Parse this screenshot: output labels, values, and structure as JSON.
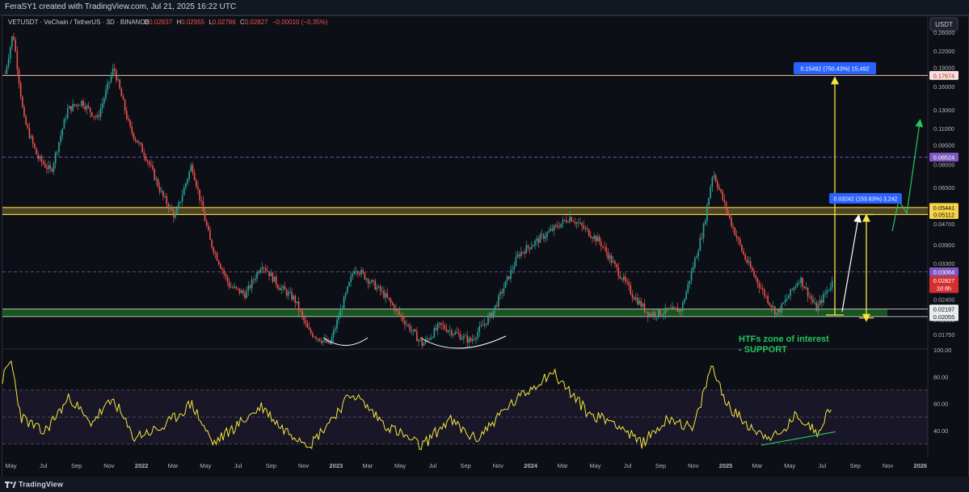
{
  "header": {
    "attribution": "FeraSY1 created with TradingView.com, Jul 21, 2025 16:22 UTC",
    "brand": "TradingView"
  },
  "legend": {
    "symbol": "VETUSDT · VeChain / TetherUS · 3D · BINANCE",
    "o_label": "O",
    "o_value": "0.02837",
    "h_label": "H",
    "h_value": "0.02955",
    "l_label": "L",
    "l_value": "0.02786",
    "c_label": "C",
    "c_value": "0.02827",
    "change": "−0.00010 (−0.35%)"
  },
  "price_axis": {
    "currency": "USDT",
    "scale": "log",
    "ticks": [
      "0.26000",
      "0.22000",
      "0.19000",
      "0.16000",
      "0.13000",
      "0.11000",
      "0.09500",
      "0.08000",
      "0.06500",
      "0.04700",
      "0.03900",
      "0.03300",
      "0.02400",
      "0.02000",
      "0.01750"
    ],
    "badges": [
      {
        "text": "0.17674",
        "value": 0.17674,
        "bg": "#f8e0dc",
        "fg": "#b03028"
      },
      {
        "text": "0.08524",
        "value": 0.08524,
        "bg": "#7e57c2",
        "fg": "#ffffff"
      },
      {
        "text": "0.05441",
        "value": 0.05441,
        "bg": "#f5d34a",
        "fg": "#111111"
      },
      {
        "text": "0.05112",
        "value": 0.05112,
        "bg": "#f5d34a",
        "fg": "#111111"
      },
      {
        "text": "0.03064",
        "value": 0.03064,
        "bg": "#7e57c2",
        "fg": "#ffffff"
      },
      {
        "text": "0.02197",
        "value": 0.02197,
        "bg": "#e8eaed",
        "fg": "#111111"
      },
      {
        "text": "0.02055",
        "value": 0.02055,
        "bg": "#e8eaed",
        "fg": "#111111"
      }
    ],
    "last_price": {
      "price": "0.02827",
      "countdown": "2d 8h",
      "value": 0.02827,
      "bg": "#d32f2f",
      "fg": "#ffffff"
    }
  },
  "time_axis": {
    "labels": [
      "May",
      "Jul",
      "Sep",
      "Nov",
      "2022",
      "Mar",
      "May",
      "Jul",
      "Sep",
      "Nov",
      "2023",
      "Mar",
      "May",
      "Jul",
      "Sep",
      "Nov",
      "2024",
      "Mar",
      "May",
      "Jul",
      "Sep",
      "Nov",
      "2025",
      "Mar",
      "May",
      "Jul",
      "Sep",
      "Nov",
      "2026"
    ],
    "bold_labels": [
      "2022",
      "2023",
      "2024",
      "2025",
      "2026"
    ]
  },
  "annotations": {
    "target_high": "0.15492 (750.43%) 15,492",
    "target_mid": "0.03242 (153.83%) 3,242",
    "zone_line1": "HTFs zone of interest",
    "zone_line2": "- SUPPORT"
  },
  "rsi_axis": {
    "ticks": [
      "100.00",
      "80.00",
      "60.00",
      "40.00"
    ]
  },
  "colors": {
    "up": "#26a69a",
    "down": "#ef5350",
    "rsi": "#f5e642",
    "support_zone": "#1b5e20",
    "resistance_zone": "#f5d34a",
    "dashed_level": "#7e57c2",
    "projection_yellow": "#f5e642",
    "projection_green": "#22c55e",
    "projection_white": "#ffffff",
    "label_blue": "#2962ff"
  },
  "chart_data": [
    {
      "type": "candlestick",
      "title": "VETUSDT · VeChain / TetherUS · 3D · BINANCE",
      "yscale": "log",
      "ylim": [
        0.0155,
        0.3
      ],
      "x_range": [
        "2021-04-15",
        "2026-01-15"
      ],
      "levels": {
        "resistance_zone": [
          0.05112,
          0.05441
        ],
        "support_zone": [
          0.02055,
          0.02197
        ],
        "dashed": [
          0.08524,
          0.03064
        ],
        "horizontal": [
          0.17674
        ]
      },
      "price_path": [
        {
          "t": "2021-04-20",
          "p": 0.18
        },
        {
          "t": "2021-05-05",
          "p": 0.26
        },
        {
          "t": "2021-05-25",
          "p": 0.12
        },
        {
          "t": "2021-06-20",
          "p": 0.085
        },
        {
          "t": "2021-07-15",
          "p": 0.075
        },
        {
          "t": "2021-08-15",
          "p": 0.13
        },
        {
          "t": "2021-09-10",
          "p": 0.14
        },
        {
          "t": "2021-10-10",
          "p": 0.12
        },
        {
          "t": "2021-11-10",
          "p": 0.19
        },
        {
          "t": "2021-12-10",
          "p": 0.11
        },
        {
          "t": "2022-01-10",
          "p": 0.085
        },
        {
          "t": "2022-02-10",
          "p": 0.06
        },
        {
          "t": "2022-03-05",
          "p": 0.05
        },
        {
          "t": "2022-04-05",
          "p": 0.08
        },
        {
          "t": "2022-05-10",
          "p": 0.04
        },
        {
          "t": "2022-06-15",
          "p": 0.027
        },
        {
          "t": "2022-07-15",
          "p": 0.025
        },
        {
          "t": "2022-08-15",
          "p": 0.033
        },
        {
          "t": "2022-09-15",
          "p": 0.027
        },
        {
          "t": "2022-10-15",
          "p": 0.024
        },
        {
          "t": "2022-11-10",
          "p": 0.018
        },
        {
          "t": "2022-12-20",
          "p": 0.016
        },
        {
          "t": "2023-02-05",
          "p": 0.032
        },
        {
          "t": "2023-04-01",
          "p": 0.025
        },
        {
          "t": "2023-06-12",
          "p": 0.016
        },
        {
          "t": "2023-07-15",
          "p": 0.019
        },
        {
          "t": "2023-09-10",
          "p": 0.0165
        },
        {
          "t": "2023-10-20",
          "p": 0.021
        },
        {
          "t": "2023-12-10",
          "p": 0.036
        },
        {
          "t": "2024-03-15",
          "p": 0.05
        },
        {
          "t": "2024-05-10",
          "p": 0.04
        },
        {
          "t": "2024-07-10",
          "p": 0.025
        },
        {
          "t": "2024-08-10",
          "p": 0.021
        },
        {
          "t": "2024-10-10",
          "p": 0.022
        },
        {
          "t": "2024-11-20",
          "p": 0.045
        },
        {
          "t": "2024-12-08",
          "p": 0.075
        },
        {
          "t": "2025-01-10",
          "p": 0.048
        },
        {
          "t": "2025-02-05",
          "p": 0.035
        },
        {
          "t": "2025-03-10",
          "p": 0.026
        },
        {
          "t": "2025-04-07",
          "p": 0.021
        },
        {
          "t": "2025-05-20",
          "p": 0.029
        },
        {
          "t": "2025-06-20",
          "p": 0.022
        },
        {
          "t": "2025-07-21",
          "p": 0.02827
        }
      ],
      "ohlc_last": {
        "o": 0.02837,
        "h": 0.02955,
        "l": 0.02786,
        "c": 0.02827
      }
    },
    {
      "type": "line",
      "title": "",
      "ylim": [
        20,
        100
      ],
      "levels": [
        70,
        50,
        30
      ],
      "series": [
        {
          "values_path": [
            {
              "t": "2021-04-15",
              "v": 78
            },
            {
              "t": "2021-05-01",
              "v": 92
            },
            {
              "t": "2021-05-20",
              "v": 50
            },
            {
              "t": "2021-07-01",
              "v": 38
            },
            {
              "t": "2021-08-20",
              "v": 65
            },
            {
              "t": "2021-09-25",
              "v": 45
            },
            {
              "t": "2021-11-10",
              "v": 63
            },
            {
              "t": "2021-12-15",
              "v": 35
            },
            {
              "t": "2022-02-10",
              "v": 42
            },
            {
              "t": "2022-04-05",
              "v": 60
            },
            {
              "t": "2022-05-15",
              "v": 30
            },
            {
              "t": "2022-08-15",
              "v": 58
            },
            {
              "t": "2022-09-20",
              "v": 42
            },
            {
              "t": "2022-11-15",
              "v": 30
            },
            {
              "t": "2023-02-01",
              "v": 68
            },
            {
              "t": "2023-04-01",
              "v": 45
            },
            {
              "t": "2023-06-10",
              "v": 28
            },
            {
              "t": "2023-08-01",
              "v": 48
            },
            {
              "t": "2023-09-20",
              "v": 33
            },
            {
              "t": "2023-11-15",
              "v": 56
            },
            {
              "t": "2024-02-10",
              "v": 84
            },
            {
              "t": "2024-04-20",
              "v": 52
            },
            {
              "t": "2024-06-10",
              "v": 46
            },
            {
              "t": "2024-07-25",
              "v": 30
            },
            {
              "t": "2024-09-20",
              "v": 50
            },
            {
              "t": "2024-11-01",
              "v": 40
            },
            {
              "t": "2024-12-05",
              "v": 88
            },
            {
              "t": "2025-01-10",
              "v": 55
            },
            {
              "t": "2025-03-05",
              "v": 38
            },
            {
              "t": "2025-04-10",
              "v": 35
            },
            {
              "t": "2025-05-15",
              "v": 52
            },
            {
              "t": "2025-06-20",
              "v": 38
            },
            {
              "t": "2025-07-21",
              "v": 61
            }
          ]
        }
      ]
    }
  ]
}
